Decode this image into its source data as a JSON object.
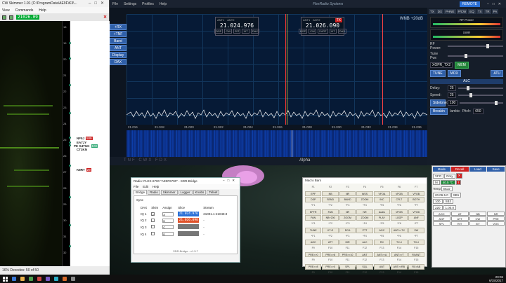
{
  "skimmer": {
    "title": "CW Skimmer 1.91 (C:\\ProgramData\\AE9F\\K3\\...",
    "menu": [
      "View",
      "Commands",
      "Help"
    ],
    "frequency": "21026.09",
    "axis": [
      "18",
      "19",
      "20",
      "21",
      "22",
      "23",
      "24",
      "25",
      "26",
      "27",
      "28",
      "29",
      "30",
      "31",
      "32"
    ],
    "callsigns": [
      {
        "call": "NF5J",
        "badge": "509"
      },
      {
        "call": "EA7JY",
        "badge": ""
      },
      {
        "call": "PE G4TUK",
        "badge": "100"
      },
      {
        "call": "CT3KN",
        "badge": ""
      },
      {
        "call": "K8RT",
        "badge": "29"
      }
    ],
    "status": "16%   Decodes: 50 of 50"
  },
  "sdr": {
    "menu": [
      "File",
      "Settings",
      "Profiles",
      "Help"
    ],
    "brand": "FlexRadio Systems",
    "remote": "REMOTE",
    "left_buttons": [
      "+RX",
      "+TNF",
      "Band",
      "ANT",
      "Display",
      "DAX"
    ],
    "wnb": "WNB  +20dB",
    "slice_a": {
      "ant1": "ANT1",
      "ant2": "ANT2",
      "freq": "21.024.976",
      "modes": [
        "DSP",
        "CW",
        "RIT",
        "XIT",
        "DAX"
      ]
    },
    "slice_b": {
      "ant1": "ANT1",
      "ant2": "ANT2",
      "freq": "21.026.090",
      "tx": "TX",
      "modes": [
        "DSP",
        "CW",
        "XVRT",
        "XIT",
        "DAX"
      ]
    },
    "freq_ticks": [
      "21.016",
      "21.018",
      "21.020",
      "21.022",
      "21.024",
      "21.026",
      "21.028",
      "21.030",
      "21.032",
      "21.034",
      "21.036"
    ],
    "status_left": "TNF  CWX  FDX",
    "status_center": "Alpha"
  },
  "panel": {
    "tabs": [
      "TX",
      "DX",
      "PHNE",
      "P/CW",
      "EQ",
      "TX",
      "TR",
      "PA"
    ],
    "rf_power": "RF Power",
    "swr": "SWR",
    "labels": [
      "RF Power:",
      "Tune Pwr:"
    ],
    "tx_profile": "XOPR_TX2",
    "buttons": [
      "TUNE",
      "MOX",
      "ATU",
      "MEM"
    ],
    "alc": "ALC",
    "delay_label": "Delay:",
    "delay": "25",
    "speed_label": "Speed:",
    "speed": "25",
    "sidetone_label": "Sidetone:",
    "sidetone": "100",
    "iambic": "Iambic",
    "pitch_label": "Pitch:",
    "pitch": "650",
    "breakin": "Breakin"
  },
  "bridge": {
    "title": "Radio: FLEX-6700 \"AE9F6700\" - SDR-Bridge",
    "menu": [
      "File",
      "Edit",
      "Help"
    ],
    "tabs": [
      "Bridge",
      "Radio",
      "Skimmer",
      "Logger",
      "Knobs",
      "Telnet"
    ],
    "sync": "Sync",
    "headers": [
      "DAX",
      "Skim",
      "Assign",
      "Slice",
      "Stream"
    ],
    "rows": [
      {
        "dax": "IQ 1",
        "assign": "A",
        "slice": "21.024.976",
        "color": "#2a6fd6",
        "stream": "21001.1-21048.9"
      },
      {
        "dax": "IQ 2",
        "assign": "B",
        "slice": "21.026.090",
        "color": "#e0522a",
        "stream": "-"
      },
      {
        "dax": "IQ 3",
        "assign": "C",
        "slice": "",
        "color": "#777777",
        "stream": "-"
      },
      {
        "dax": "IQ 4",
        "assign": "D",
        "slice": "",
        "color": "#777777",
        "stream": "-"
      }
    ],
    "footer": "SDR-Bridge - v1.5.7"
  },
  "macro": {
    "title": "Macro Bars",
    "cells": [
      "F1",
      "F2",
      "F3",
      "F4",
      "F5",
      "F6",
      "F7",
      "EPF",
      "NB",
      "NR",
      "WSS",
      "VFOA",
      "VFOB",
      "VFOB",
      "DSP",
      "SEND",
      "BAND",
      "ZOOM",
      "INC",
      "CFLT",
      "BOTH",
      "*F1",
      "*F2",
      "*F3",
      "*F4",
      "*F5",
      "*F6",
      "*F7",
      "EPTR",
      "FAN",
      "NR",
      "NR",
      "Audio",
      "VFOB",
      "VFOD",
      "PAN",
      "NB+200",
      "ZOOM",
      "ZOOM",
      "PLAY",
      "LOOP",
      "ANF",
      "^F1",
      "^F2",
      "^F3",
      "^F4",
      "^F5",
      "^F6",
      "^F7",
      "TUNE",
      "KT-G",
      "RCA",
      "PTT",
      "AGC",
      "ANT>>TX",
      "SW",
      "*F1",
      "*F2",
      "*F3",
      "*F4",
      "*F5",
      "*F6",
      "*F7",
      "AGC",
      "ATT",
      "DIR",
      "ALC",
      "RX",
      "TX>I",
      "TX>I",
      "F9",
      "F10",
      "F11",
      "F12",
      "F13",
      "F14",
      "F15",
      "PRE>>0",
      "PRE>>8",
      "PRE>>10",
      "ANT",
      "ANT>>A",
      "ANT>>T",
      "RXANT",
      "F9",
      "F10",
      "F11",
      "F12",
      "F13",
      "F14",
      "F15",
      "PRE>>8",
      "PRE>>0",
      "SPL",
      "SQL",
      "ANT",
      "ANT>>RB",
      "RX>AB",
      "F9",
      "F10",
      "F11",
      "F12",
      "F13",
      "F14",
      "F15",
      "PRE>>8",
      "SN",
      "SPL",
      "SPLIT",
      "AGC",
      "ANT>>A",
      "TXDR"
    ]
  },
  "rig": {
    "top": [
      "Mode",
      "Recall",
      "Load",
      "Save"
    ],
    "vfo": "VFO",
    "vfo_val": "Dmy",
    "mbox": "M",
    "freq_c": "40.5 °C",
    "temp_label": "Temp",
    "bcd": "BCD",
    "vals": [
      "20.06.5.0",
      "SB1",
      "100",
      "SB3",
      "220",
      "1.00.0"
    ],
    "keys": [
      "AGC",
      "AT",
      "NB",
      "NR",
      "ANF",
      "ATT",
      "CW",
      "PRE",
      "SPL",
      "RIT",
      "XIT",
      "VOX"
    ]
  },
  "taskbar": {
    "time": "20:06",
    "date": "6/15/2017"
  }
}
